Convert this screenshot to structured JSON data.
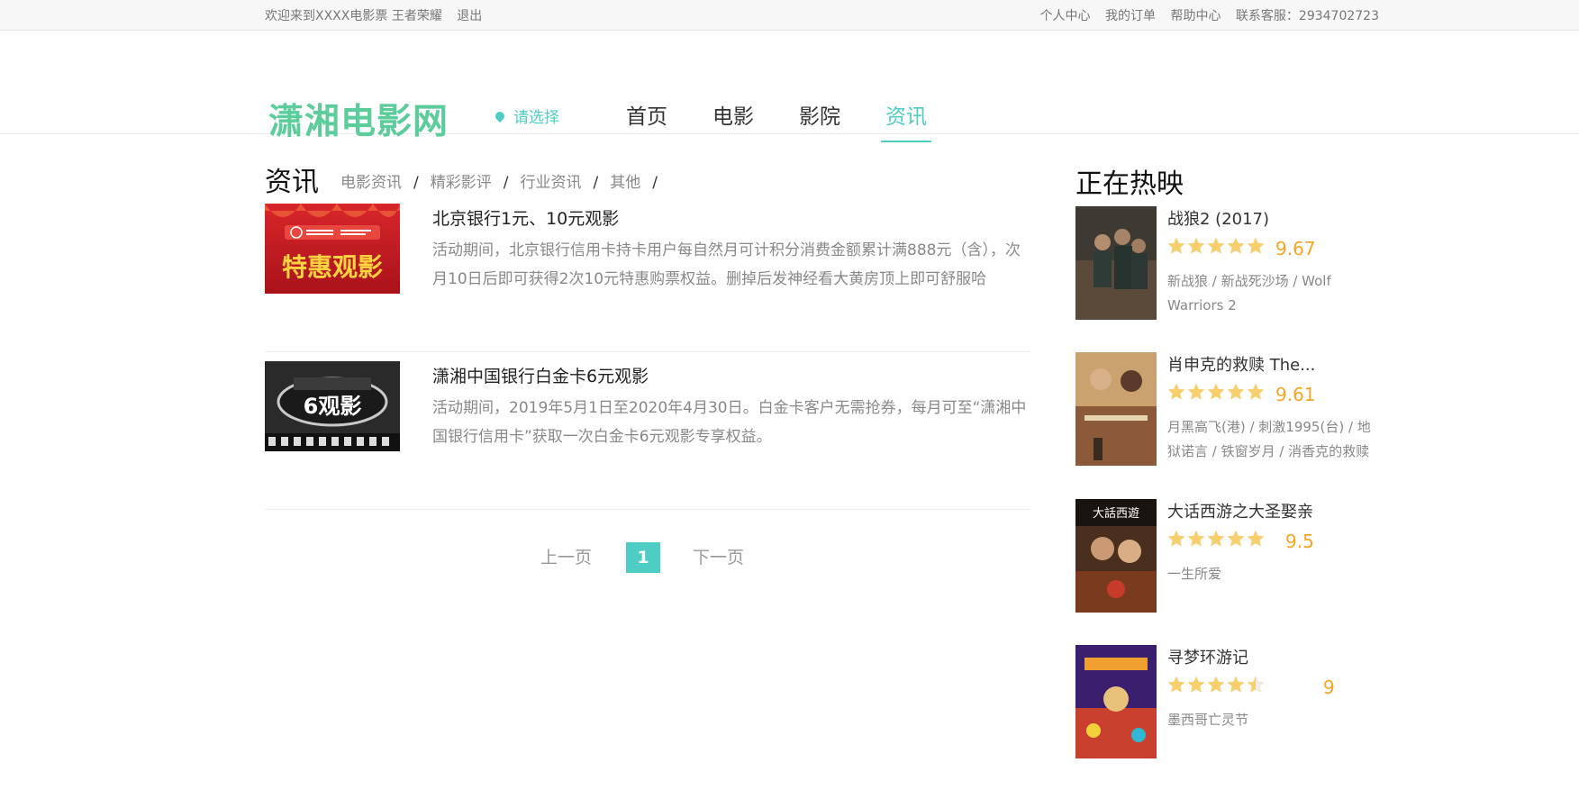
{
  "topbar": {
    "welcome": "欢迎来到XXXX电影票 王者荣耀",
    "logout": "退出",
    "links": [
      "个人中心",
      "我的订单",
      "帮助中心"
    ],
    "service": "联系客服：2934702723"
  },
  "header": {
    "logo": "潇湘电影网",
    "city": "请选择",
    "nav": [
      "首页",
      "电影",
      "影院",
      "资讯"
    ],
    "active_nav": "资讯"
  },
  "news": {
    "title": "资讯",
    "categories": [
      "电影资讯",
      "精彩影评",
      "行业资讯",
      "其他"
    ],
    "items": [
      {
        "title": "北京银行1元、10元观影",
        "desc": "活动期间，北京银行信用卡持卡用户每自然月可计积分消费金额累计满888元（含），次月10日后即可获得2次10元特惠购票权益。删掉后发神经看大黄房顶上即可舒服哈",
        "thumb_text": "特惠观影"
      },
      {
        "title": "潇湘中国银行白金卡6元观影",
        "desc": "活动期间，2019年5月1日至2020年4月30日。白金卡客户无需抢券，每月可至“潇湘中国银行信用卡”获取一次白金卡6元观影专享权益。",
        "thumb_text": "6观影"
      }
    ],
    "pager": {
      "prev": "上一页",
      "current": "1",
      "next": "下一页"
    }
  },
  "hot": {
    "title": "正在热映",
    "movies": [
      {
        "name": "战狼2 (2017)",
        "score": "9.67",
        "stars": 5,
        "aka": "新战狼 / 新战死沙场 / Wolf Warriors 2"
      },
      {
        "name": "肖申克的救赎 The...",
        "score": "9.61",
        "stars": 5,
        "aka": "月黑高飞(港) / 刺激1995(台) / 地狱诺言 / 铁窗岁月 / 消香克的救赎"
      },
      {
        "name": "大话西游之大圣娶亲",
        "score": "9.5",
        "stars": 5,
        "aka": "一生所爱"
      },
      {
        "name": "寻梦环游记",
        "score": "9",
        "stars": 4.5,
        "aka": "墨西哥亡灵节"
      }
    ]
  },
  "colors": {
    "accent": "#4ecdc4",
    "logo": "#5ccc9a",
    "score": "#f5a623"
  }
}
